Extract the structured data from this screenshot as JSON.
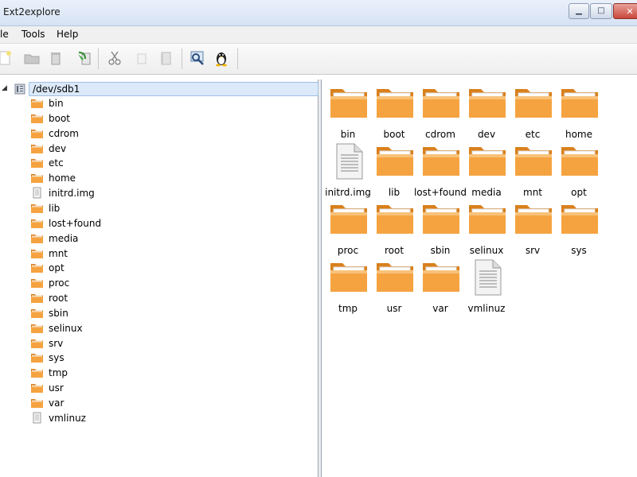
{
  "window": {
    "title": "Ext2explore"
  },
  "menu": [
    "le",
    "Tools",
    "Help"
  ],
  "toolbar": {
    "buttons": [
      "new-icon",
      "open-icon",
      "delete-icon",
      "save-icon",
      "cut-icon",
      "copy-icon",
      "paste-icon",
      "search-icon",
      "linux-icon"
    ]
  },
  "tree": {
    "root": "/dev/sdb1",
    "items": [
      {
        "label": "bin",
        "type": "folder"
      },
      {
        "label": "boot",
        "type": "folder"
      },
      {
        "label": "cdrom",
        "type": "folder"
      },
      {
        "label": "dev",
        "type": "folder"
      },
      {
        "label": "etc",
        "type": "folder"
      },
      {
        "label": "home",
        "type": "folder"
      },
      {
        "label": "initrd.img",
        "type": "file"
      },
      {
        "label": "lib",
        "type": "folder"
      },
      {
        "label": "lost+found",
        "type": "folder"
      },
      {
        "label": "media",
        "type": "folder"
      },
      {
        "label": "mnt",
        "type": "folder"
      },
      {
        "label": "opt",
        "type": "folder"
      },
      {
        "label": "proc",
        "type": "folder"
      },
      {
        "label": "root",
        "type": "folder"
      },
      {
        "label": "sbin",
        "type": "folder"
      },
      {
        "label": "selinux",
        "type": "folder"
      },
      {
        "label": "srv",
        "type": "folder"
      },
      {
        "label": "sys",
        "type": "folder"
      },
      {
        "label": "tmp",
        "type": "folder"
      },
      {
        "label": "usr",
        "type": "folder"
      },
      {
        "label": "var",
        "type": "folder"
      },
      {
        "label": "vmlinuz",
        "type": "file"
      }
    ]
  },
  "grid": {
    "items": [
      {
        "label": "bin",
        "type": "folder"
      },
      {
        "label": "boot",
        "type": "folder"
      },
      {
        "label": "cdrom",
        "type": "folder"
      },
      {
        "label": "dev",
        "type": "folder"
      },
      {
        "label": "etc",
        "type": "folder"
      },
      {
        "label": "home",
        "type": "folder"
      },
      {
        "label": "initrd.img",
        "type": "file"
      },
      {
        "label": "lib",
        "type": "folder"
      },
      {
        "label": "lost+found",
        "type": "folder"
      },
      {
        "label": "media",
        "type": "folder"
      },
      {
        "label": "mnt",
        "type": "folder"
      },
      {
        "label": "opt",
        "type": "folder"
      },
      {
        "label": "proc",
        "type": "folder"
      },
      {
        "label": "root",
        "type": "folder"
      },
      {
        "label": "sbin",
        "type": "folder"
      },
      {
        "label": "selinux",
        "type": "folder"
      },
      {
        "label": "srv",
        "type": "folder"
      },
      {
        "label": "sys",
        "type": "folder"
      },
      {
        "label": "tmp",
        "type": "folder"
      },
      {
        "label": "usr",
        "type": "folder"
      },
      {
        "label": "var",
        "type": "folder"
      },
      {
        "label": "vmlinuz",
        "type": "file"
      }
    ]
  },
  "colors": {
    "folder": "#f5a340",
    "folder_dark": "#d9801c",
    "selection": "#dce9f8"
  }
}
